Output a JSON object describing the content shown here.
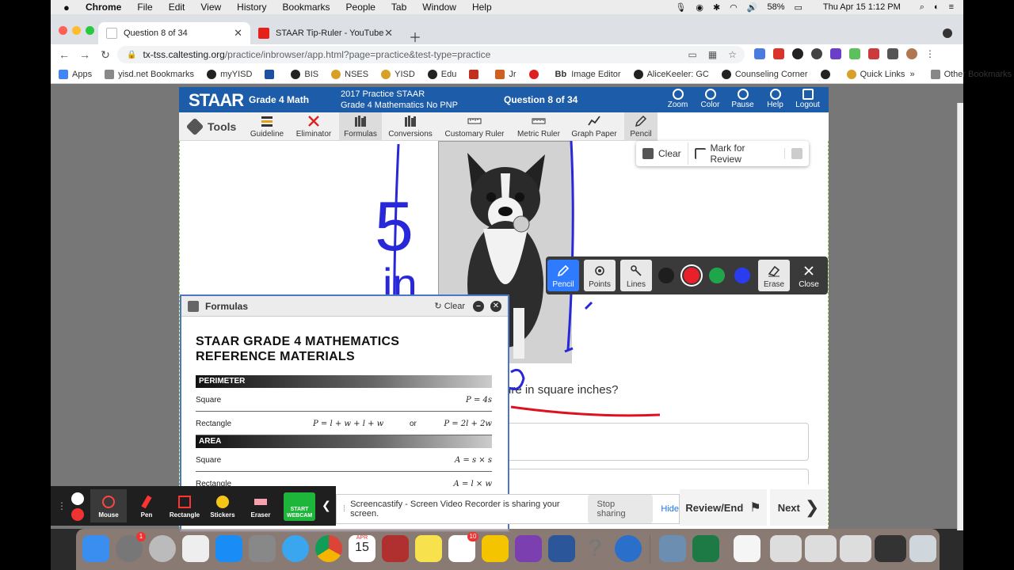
{
  "mac_menu": {
    "app": "Chrome",
    "items": [
      "File",
      "Edit",
      "View",
      "History",
      "Bookmarks",
      "People",
      "Tab",
      "Window",
      "Help"
    ],
    "battery": "58%",
    "datetime": "Thu Apr 15  1:12 PM"
  },
  "browser": {
    "tabs": [
      {
        "title": "Question 8 of 34",
        "active": true
      },
      {
        "title": "STAAR Tip-Ruler - YouTube",
        "active": false
      }
    ],
    "url_host": "tx-tss.caltesting.org",
    "url_path": "/practice/inbrowser/app.html?page=practice&test-type=practice",
    "bookmarks": [
      "Apps",
      "yisd.net Bookmarks",
      "myYISD",
      "BIS",
      "NSES",
      "YISD",
      "Edu",
      "Jr",
      "Image Editor",
      "AliceKeeler: GC",
      "Counseling Corner",
      "Quick Links"
    ],
    "bookmarks_more": "»",
    "other_bookmarks": "Other Bookmarks",
    "bb_label": "Bb"
  },
  "staar": {
    "logo": "STAAR",
    "grade": "Grade 4 Math",
    "practice_line1": "2017 Practice STAAR",
    "practice_line2": "Grade 4 Mathematics No PNP",
    "question_count": "Question 8 of 34",
    "head_tools": [
      "Zoom",
      "Color",
      "Pause",
      "Help",
      "Logout"
    ],
    "tools_label": "Tools",
    "toolbar": [
      "Guideline",
      "Eliminator",
      "Formulas",
      "Conversions",
      "Customary Ruler",
      "Metric Ruler",
      "Graph Paper",
      "Pencil"
    ],
    "clear": "Clear",
    "mark_review": "Mark for Review",
    "question_text": "ure in square inches?",
    "review_end": "Review/End",
    "next": "Next"
  },
  "pencil_tools": {
    "tools": [
      "Pencil",
      "Points",
      "Lines"
    ],
    "erase": "Erase",
    "close": "Close",
    "colors": [
      "#1e1e1e",
      "#e8202a",
      "#1fa64a",
      "#2a3cf0"
    ],
    "selected_color": "#e8202a"
  },
  "formulas": {
    "header": "Formulas",
    "clear": "Clear",
    "title_line1": "STAAR GRADE 4 MATHEMATICS",
    "title_line2": "REFERENCE MATERIALS",
    "perimeter": {
      "band": "PERIMETER",
      "rows": [
        {
          "label": "Square",
          "f1": "",
          "or": "",
          "f2": "P = 4s"
        },
        {
          "label": "Rectangle",
          "f1": "P = l + w + l + w",
          "or": "or",
          "f2": "P = 2l + 2w"
        }
      ]
    },
    "area": {
      "band": "AREA",
      "rows": [
        {
          "label": "Square",
          "f1": "",
          "or": "",
          "f2": "A = s × s"
        },
        {
          "label": "Rectangle",
          "f1": "",
          "or": "",
          "f2": "A = l × w"
        }
      ]
    }
  },
  "annotations": {
    "num": "5",
    "unit": "in"
  },
  "screencastify": {
    "buttons": [
      "Mouse",
      "Pen",
      "Rectangle",
      "Stickers",
      "Eraser"
    ],
    "webcam_line1": "START",
    "webcam_line2": "WEBCAM",
    "share_text": "Screencastify - Screen Video Recorder is sharing your screen.",
    "stop_sharing": "Stop sharing",
    "hide": "Hide"
  },
  "dock": {
    "badge_settings": "1",
    "badge_reminders": "10",
    "calendar_month": "APR",
    "calendar_day": "15"
  }
}
